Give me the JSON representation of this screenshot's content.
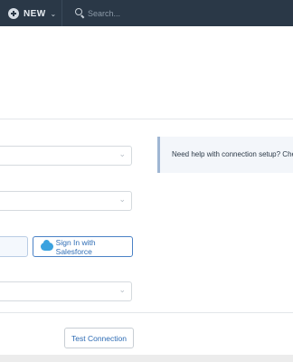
{
  "topbar": {
    "new_label": "NEW",
    "search_placeholder": "Search...",
    "icons": {
      "new": "plus-circle-icon",
      "new_caret": "chevron-down-icon",
      "search": "search-icon"
    }
  },
  "form": {
    "salesforce_button_label": "Sign In with Salesforce",
    "test_connection_label": "Test Connection"
  },
  "help_box": {
    "text": "Need help with connection setup? Che"
  },
  "colors": {
    "topbar_bg": "#2a3847",
    "accent_blue": "#2f6db5",
    "salesforce_blue": "#3ba2df",
    "help_bg": "#f3f6fa",
    "help_border": "#9fb6d3"
  }
}
